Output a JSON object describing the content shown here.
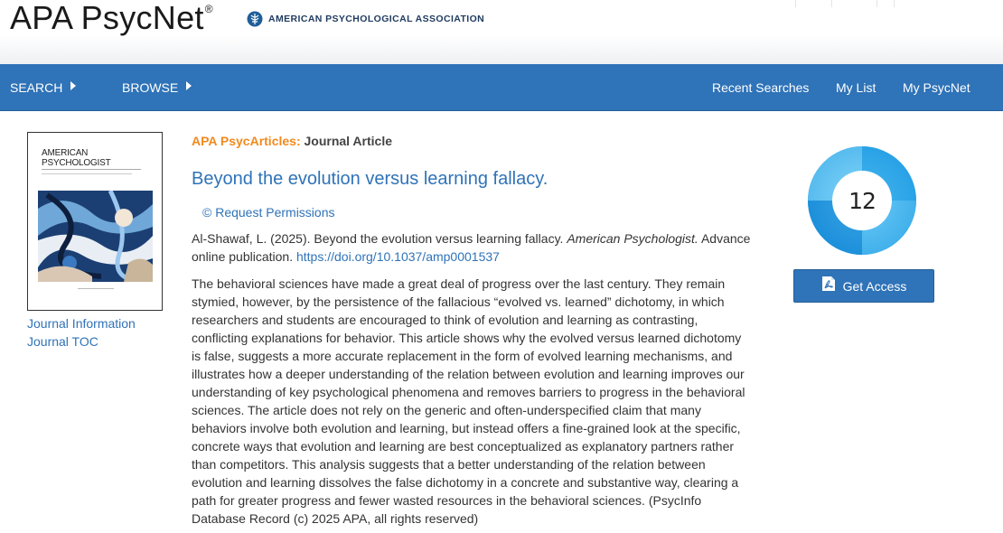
{
  "header": {
    "logo_text": "APA PsycNet",
    "logo_mark": "®",
    "org_name": "AMERICAN PSYCHOLOGICAL ASSOCIATION"
  },
  "nav": {
    "search": "SEARCH",
    "browse": "BROWSE",
    "recent_searches": "Recent Searches",
    "my_list": "My List",
    "my_psycnet": "My PsycNet"
  },
  "cover": {
    "title_line1": "AMERICAN",
    "title_line2": "PSYCHOLOGIST"
  },
  "sidebar": {
    "journal_information": "Journal Information",
    "journal_toc": "Journal TOC"
  },
  "article": {
    "database": "APA PsycArticles:",
    "type": "Journal Article",
    "title": "Beyond the evolution versus learning fallacy.",
    "request_permissions": "© Request Permissions",
    "citation_authors_year": "Al-Shawaf, L. (2025). Beyond the evolution versus learning fallacy. ",
    "citation_journal": "American Psychologist.",
    "citation_rest": " Advance online publication. ",
    "doi": "https://doi.org/10.1037/amp0001537",
    "abstract": "The behavioral sciences have made a great deal of progress over the last century. They remain stymied, however, by the persistence of the fallacious “evolved vs. learned” dichotomy, in which researchers and students are encouraged to think of evolution and learning as contrasting, conflicting explanations for behavior. This article shows why the evolved versus learned dichotomy is false, suggests a more accurate replacement in the form of evolved learning mechanisms, and illustrates how a deeper understanding of the relation between evolution and learning improves our understanding of key psychological phenomena and removes barriers to progress in the behavioral sciences. The article does not rely on the generic and often-underspecified claim that many behaviors involve both evolution and learning, but instead offers a fine-grained look at the specific, concrete ways that evolution and learning are best conceptualized as explanatory partners rather than competitors. This analysis suggests that a better understanding of the relation between evolution and learning dissolves the false dichotomy in a concrete and substantive way, clearing a path for greater progress and fewer wasted resources in the behavioral sciences. (PsycInfo Database Record (c) 2025 APA, all rights reserved)"
  },
  "altmetric": {
    "score": "12",
    "icon": "altmetric-donut-icon"
  },
  "access": {
    "label": "Get Access",
    "icon": "pdf-icon"
  },
  "colors": {
    "brand_blue": "#2f73b8",
    "accent_orange": "#f18a1e",
    "altmetric_blue": "#2ea8e6"
  }
}
